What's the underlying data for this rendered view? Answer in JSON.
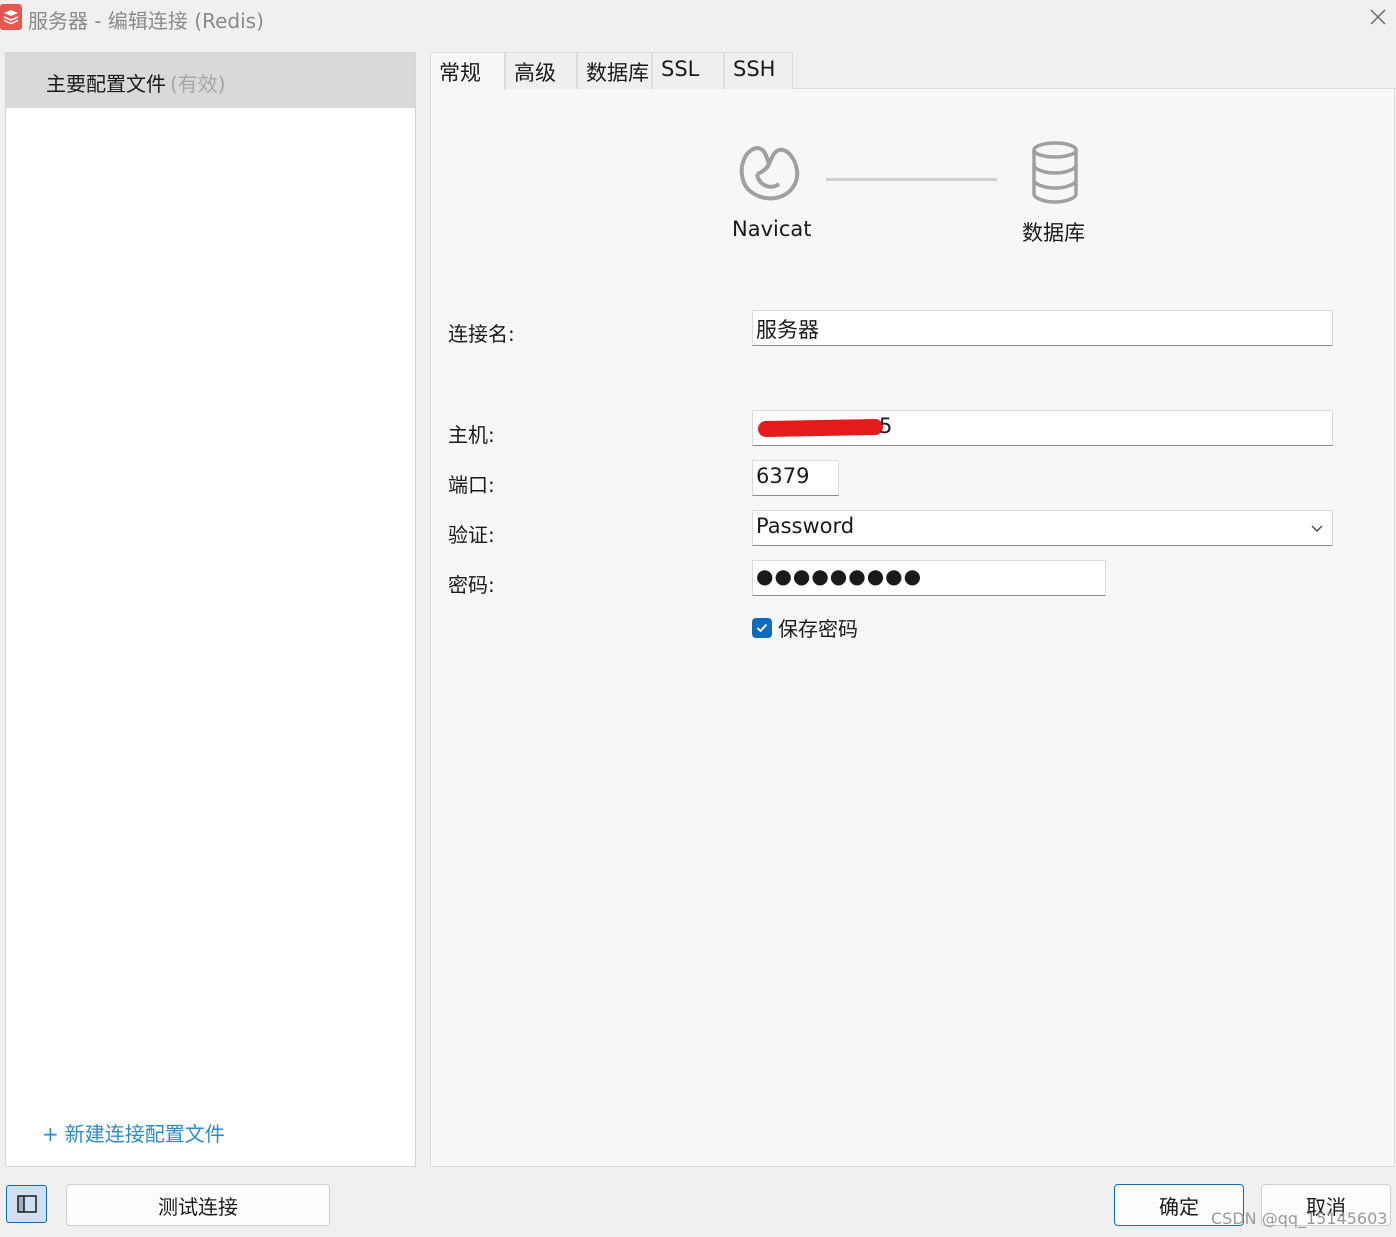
{
  "window": {
    "title": "服务器 - 编辑连接 (Redis)"
  },
  "sidebar": {
    "profile": {
      "name": "主要配置文件",
      "status": "(有效)"
    },
    "new_profile_icon": "+",
    "new_profile_label": "新建连接配置文件"
  },
  "tabs": [
    {
      "label": "常规",
      "active": true
    },
    {
      "label": "高级",
      "active": false
    },
    {
      "label": "数据库",
      "active": false
    },
    {
      "label": "SSL",
      "active": false
    },
    {
      "label": "SSH",
      "active": false
    }
  ],
  "diagram": {
    "left_label": "Navicat",
    "right_label": "数据库",
    "left_icon": "navicat-logo-icon",
    "right_icon": "database-icon"
  },
  "form": {
    "connection_name": {
      "label": "连接名:",
      "value": "服务器"
    },
    "host": {
      "label": "主机:",
      "visible_tail": "5"
    },
    "port": {
      "label": "端口:",
      "value": "6379"
    },
    "auth": {
      "label": "验证:",
      "value": "Password"
    },
    "password": {
      "label": "密码:",
      "value": "●●●●●●●●●"
    },
    "save_password": {
      "label": "保存密码",
      "checked": true
    }
  },
  "footer": {
    "test_button": "测试连接",
    "ok_button": "确定",
    "cancel_button": "取消",
    "watermark": "CSDN @qq_15145603"
  },
  "colors": {
    "accent": "#0f6cbd",
    "link": "#2e8bc9",
    "redaction": "#e51b1b",
    "app_icon": "#e8574f"
  }
}
